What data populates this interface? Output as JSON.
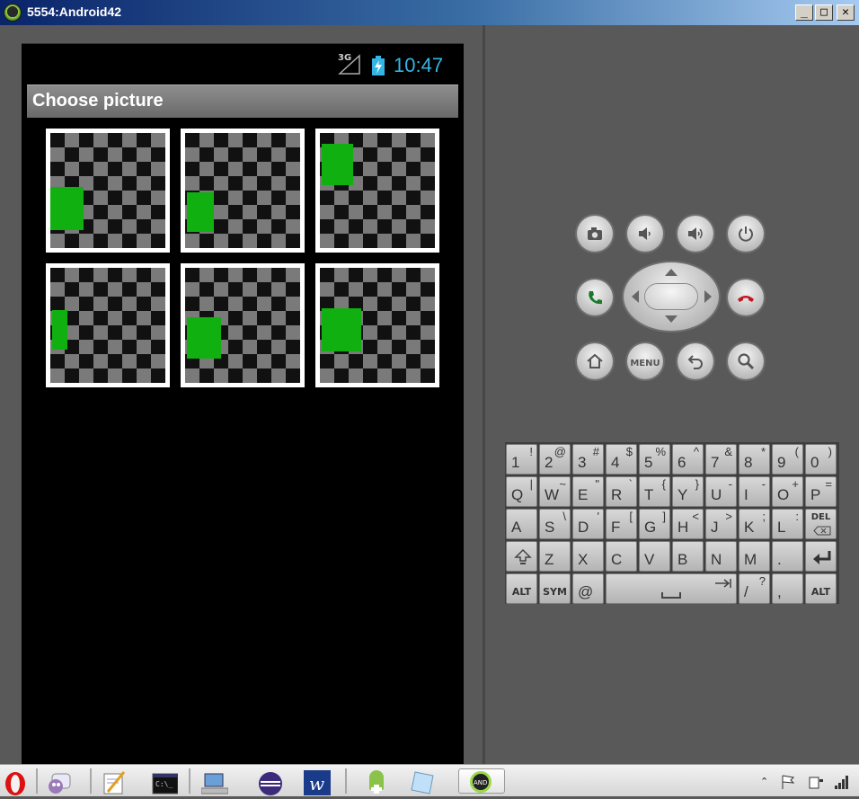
{
  "window": {
    "title": "5554:Android42",
    "min_label": "_",
    "max_label": "□",
    "close_label": "✕"
  },
  "status_bar": {
    "network": "3G",
    "time": "10:47"
  },
  "action_bar": {
    "title": "Choose picture"
  },
  "pictures": [
    {
      "name": "picture-1"
    },
    {
      "name": "picture-2"
    },
    {
      "name": "picture-3"
    },
    {
      "name": "picture-4"
    },
    {
      "name": "picture-5"
    },
    {
      "name": "picture-6"
    }
  ],
  "controls": {
    "menu_label": "MENU"
  },
  "keyboard": {
    "row1": [
      [
        "1",
        "!"
      ],
      [
        "2",
        "@"
      ],
      [
        "3",
        "#"
      ],
      [
        "4",
        "$"
      ],
      [
        "5",
        "%"
      ],
      [
        "6",
        "^"
      ],
      [
        "7",
        "&"
      ],
      [
        "8",
        "*"
      ],
      [
        "9",
        "("
      ],
      [
        "0",
        ")"
      ]
    ],
    "row2": [
      [
        "Q",
        "|"
      ],
      [
        "W",
        "~"
      ],
      [
        "E",
        "\""
      ],
      [
        "R",
        "`"
      ],
      [
        "T",
        "{"
      ],
      [
        "Y",
        "}"
      ],
      [
        "U",
        "-"
      ],
      [
        "I",
        "-"
      ],
      [
        "O",
        "+"
      ],
      [
        "P",
        "="
      ]
    ],
    "row3": [
      [
        "A",
        ""
      ],
      [
        "S",
        "\\"
      ],
      [
        "D",
        "'"
      ],
      [
        "F",
        "["
      ],
      [
        "G",
        "]"
      ],
      [
        "H",
        "<"
      ],
      [
        "J",
        ">"
      ],
      [
        "K",
        ";"
      ],
      [
        "L",
        ":"
      ]
    ],
    "row4": [
      [
        "Z",
        ""
      ],
      [
        "X",
        ""
      ],
      [
        "C",
        ""
      ],
      [
        "V",
        ""
      ],
      [
        "B",
        ""
      ],
      [
        "N",
        ""
      ],
      [
        "M",
        ""
      ],
      [
        ".",
        ""
      ]
    ],
    "del_label": "DEL",
    "alt_label": "ALT",
    "sym_label": "SYM",
    "at_label": "@",
    "slash_label": "/",
    "question_label": "?",
    "comma_label": ","
  },
  "colors": {
    "clock": "#33b5e5",
    "green_marker": "#10b010"
  }
}
